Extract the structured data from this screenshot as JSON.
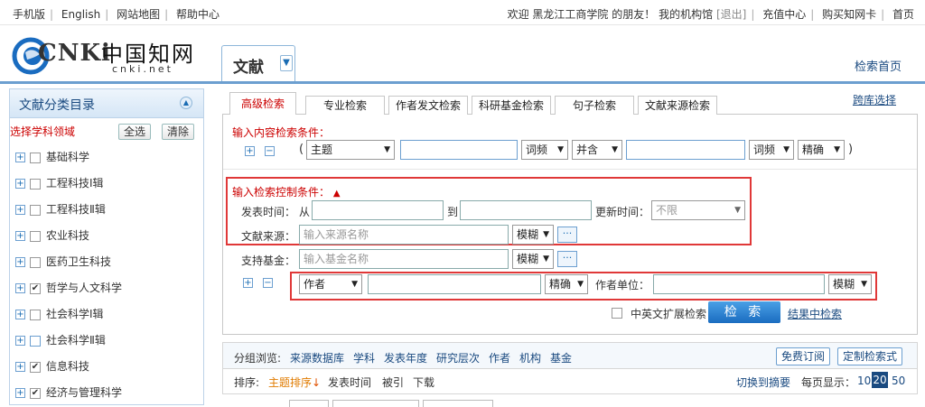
{
  "topbar": {
    "links": [
      "手机版",
      "English",
      "网站地图",
      "帮助中心"
    ],
    "welcome": "欢迎",
    "org": "黑龙江工商学院",
    "friend": "的朋友！",
    "my_org": "我的机构馆",
    "logout": "[退出]",
    "recharge": "充值中心",
    "buy_card": "购买知网卡",
    "home": "首页"
  },
  "logo": {
    "main": "CNKi",
    "cn": "中国知网",
    "url": "cnki.net"
  },
  "doc_select": {
    "label": "文献"
  },
  "search_home": "检索首页",
  "sidebar": {
    "title": "文献分类目录",
    "select_label": "选择学科领域",
    "select_all": "全选",
    "clear": "清除",
    "items": [
      {
        "label": "基础科学",
        "checked": false
      },
      {
        "label": "工程科技Ⅰ辑",
        "checked": false
      },
      {
        "label": "工程科技Ⅱ辑",
        "checked": false
      },
      {
        "label": "农业科技",
        "checked": false
      },
      {
        "label": "医药卫生科技",
        "checked": false
      },
      {
        "label": "哲学与人文科学",
        "checked": true
      },
      {
        "label": "社会科学Ⅰ辑",
        "checked": false
      },
      {
        "label": "社会科学Ⅱ辑",
        "checked": false
      },
      {
        "label": "信息科技",
        "checked": true
      },
      {
        "label": "经济与管理科学",
        "checked": true
      }
    ]
  },
  "tabs": [
    "高级检索",
    "专业检索",
    "作者发文检索",
    "科研基金检索",
    "句子检索",
    "文献来源检索"
  ],
  "cross_db": "跨库选择",
  "content_cond": {
    "label": "输入内容检索条件：",
    "open_paren": "(",
    "field": "主题",
    "freq1": "词频",
    "op": "并含",
    "freq2": "词频",
    "match": "精确",
    "close_paren": ")"
  },
  "control_cond": {
    "label": "输入检索控制条件：",
    "pub_time": "发表时间：",
    "from": "从",
    "to": "到",
    "update_time": "更新时间：",
    "update_value": "不限",
    "source_label": "文献来源：",
    "source_placeholder": "输入来源名称",
    "fuzzy1": "模糊",
    "fund_label": "支持基金：",
    "fund_placeholder": "输入基金名称",
    "fuzzy2": "模糊",
    "author_field": "作者",
    "author_match": "精确",
    "author_org_label": "作者单位：",
    "fuzzy3": "模糊",
    "dots": "···"
  },
  "bilingual": "中英文扩展检索",
  "search_btn": "检 索",
  "search_in_results": "结果中检索",
  "group_browse": {
    "label": "分组浏览:",
    "items": [
      "来源数据库",
      "学科",
      "发表年度",
      "研究层次",
      "作者",
      "机构",
      "基金"
    ],
    "free_sub": "免费订阅",
    "custom": "定制检索式"
  },
  "sort": {
    "label": "排序:",
    "active": "主题排序",
    "items": [
      "发表时间",
      "被引",
      "下载"
    ],
    "switch": "切换到摘要",
    "per_page": "每页显示：",
    "pages": [
      "10",
      "20",
      "50"
    ],
    "current": "20"
  }
}
